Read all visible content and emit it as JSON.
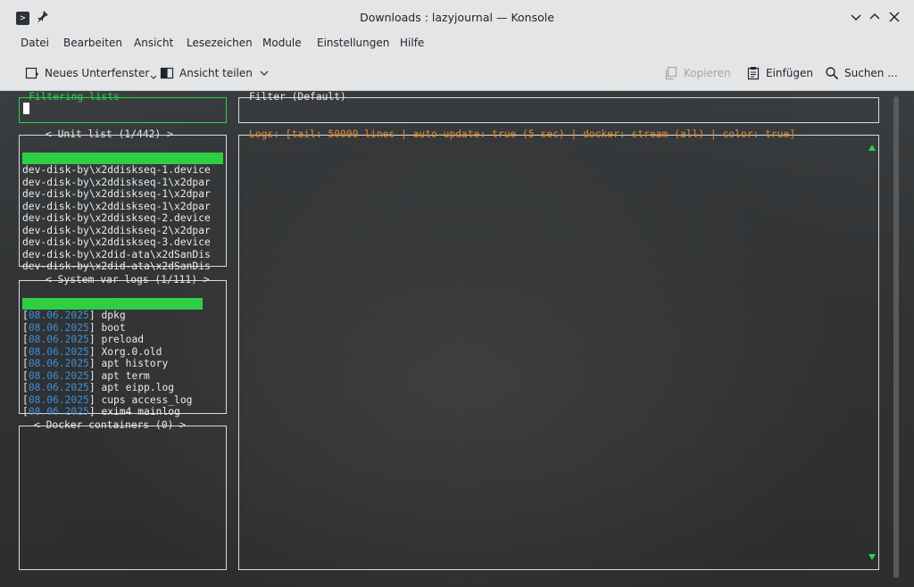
{
  "window": {
    "title": "Downloads : lazyjournal — Konsole",
    "icons": [
      "terminal-app-icon",
      "pin-icon",
      "chevron-down-icon",
      "chevron-up-icon",
      "close-icon"
    ]
  },
  "menu": [
    "Datei",
    "Bearbeiten",
    "Ansicht",
    "Lesezeichen",
    "Module",
    "Einstellungen",
    "Hilfe"
  ],
  "toolbar": {
    "new_tab": "Neues Unterfenster",
    "split_view": "Ansicht teilen",
    "copy": "Kopieren",
    "paste": "Einfügen",
    "find": "Suchen ..."
  },
  "terminal": {
    "filtering_title": "Filtering lists",
    "filter_title": "Filter (Default)",
    "unit_title": "< Unit list (1/442) >",
    "units": [
      "dev-disk-by\\x2ddiskseq-1.device",
      "dev-disk-by\\x2ddiskseq-1\\x2dpar",
      "dev-disk-by\\x2ddiskseq-1\\x2dpar",
      "dev-disk-by\\x2ddiskseq-1\\x2dpar",
      "dev-disk-by\\x2ddiskseq-2.device",
      "dev-disk-by\\x2ddiskseq-2\\x2dpar",
      "dev-disk-by\\x2ddiskseq-3.device",
      "dev-disk-by\\x2did-ata\\x2dSanDis",
      "dev-disk-by\\x2did-ata\\x2dSanDis"
    ],
    "syslog_title": "< System var logs (1/111) >",
    "syslogs": [
      {
        "date": "08.06.2025",
        "name": "dpkg"
      },
      {
        "date": "08.06.2025",
        "name": "boot"
      },
      {
        "date": "08.06.2025",
        "name": "preload"
      },
      {
        "date": "08.06.2025",
        "name": "Xorg.0.old"
      },
      {
        "date": "08.06.2025",
        "name": "apt history"
      },
      {
        "date": "08.06.2025",
        "name": "apt term"
      },
      {
        "date": "08.06.2025",
        "name": "apt eipp.log"
      },
      {
        "date": "08.06.2025",
        "name": "cups access_log"
      },
      {
        "date": "08.06.2025",
        "name": "exim4 mainlog"
      }
    ],
    "docker_title": "< Docker containers (0) >",
    "logs_title": "Logs: [tail: 50000 lines | auto-update: true (5 sec) | docker: stream (all) | color: true]",
    "colors": {
      "accent_green": "#2fcf44",
      "orange": "#e58b2a",
      "date_blue": "#3e8fd6"
    }
  }
}
